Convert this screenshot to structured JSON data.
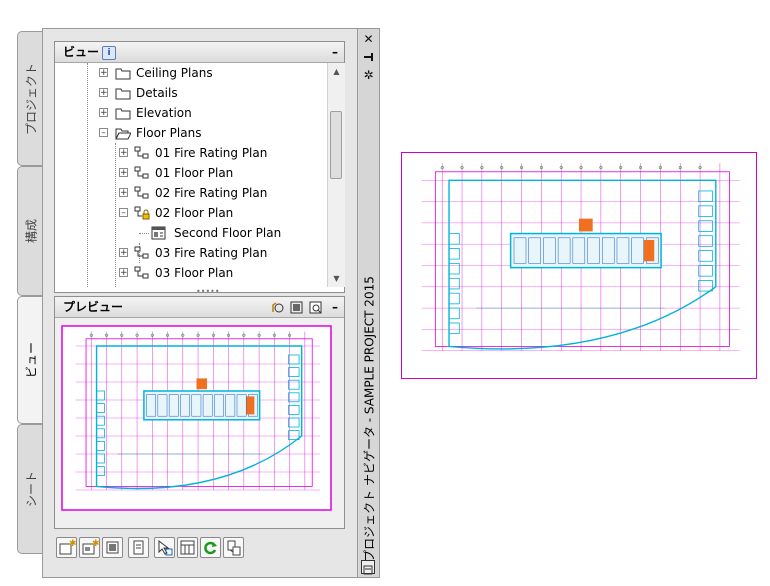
{
  "palette": {
    "title": "プロジェクト ナビゲータ - SAMPLE PROJECT 2015",
    "tabs": [
      {
        "label": "プロジェクト",
        "active": false
      },
      {
        "label": "構成",
        "active": false
      },
      {
        "label": "ビュー",
        "active": true
      },
      {
        "label": "シート",
        "active": false
      }
    ],
    "titlebar_icons": [
      "close-icon",
      "auto-hide-icon",
      "properties-icon"
    ]
  },
  "views_panel": {
    "title": "ビュー",
    "info_icon": "i",
    "minimize": "–",
    "tree": [
      {
        "label": "Ceiling Plans",
        "level": 0,
        "icon": "folder-closed-icon",
        "expander": "+"
      },
      {
        "label": "Details",
        "level": 0,
        "icon": "folder-closed-icon",
        "expander": "+"
      },
      {
        "label": "Elevation",
        "level": 0,
        "icon": "folder-closed-icon",
        "expander": "+"
      },
      {
        "label": "Floor Plans",
        "level": 0,
        "icon": "folder-open-icon",
        "expander": "–"
      },
      {
        "label": "01 Fire Rating Plan",
        "level": 1,
        "icon": "view-drawing-icon",
        "expander": "+"
      },
      {
        "label": "01 Floor Plan",
        "level": 1,
        "icon": "view-drawing-icon",
        "expander": "+"
      },
      {
        "label": "02 Fire Rating Plan",
        "level": 1,
        "icon": "view-drawing-icon",
        "expander": "+"
      },
      {
        "label": "02 Floor Plan",
        "level": 1,
        "icon": "view-drawing-locked-icon",
        "expander": "–"
      },
      {
        "label": "Second Floor Plan",
        "level": 2,
        "icon": "model-space-view-icon",
        "expander": ""
      },
      {
        "label": "03 Fire Rating Plan",
        "level": 1,
        "icon": "view-drawing-icon",
        "expander": "+"
      },
      {
        "label": "03 Floor Plan",
        "level": 1,
        "icon": "view-drawing-icon",
        "expander": "+"
      }
    ]
  },
  "preview_panel": {
    "title": "プレビュー",
    "minimize": "–",
    "tools": [
      "preview-settings-icon",
      "preview-fit-icon",
      "preview-zoom-icon"
    ]
  },
  "toolbar": {
    "buttons": [
      "new-view-icon",
      "add-view-icon",
      "regenerate-view-icon",
      "open-view-icon",
      "select-icon",
      "list-icon",
      "refresh-icon",
      "repath-icon"
    ]
  },
  "colors": {
    "magenta": "#e000e0",
    "cyan": "#00b4d8",
    "green": "#2aa02a"
  }
}
